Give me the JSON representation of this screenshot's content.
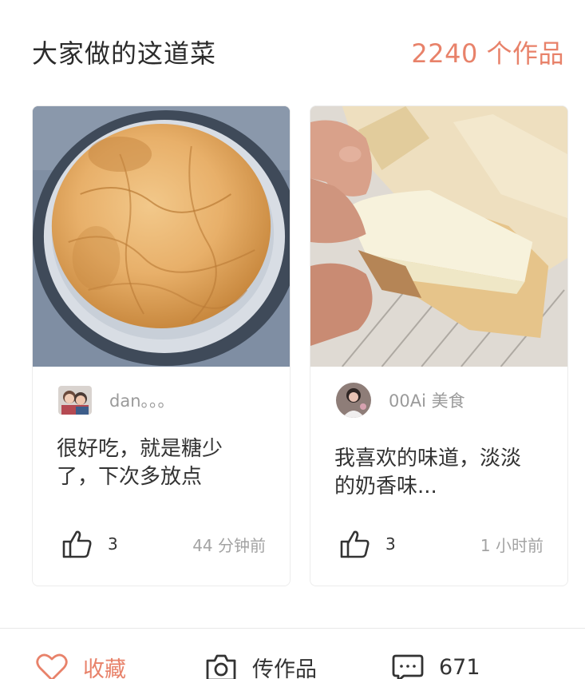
{
  "header": {
    "title": "大家做的这道菜",
    "works_count": "2240 个作品"
  },
  "cards": [
    {
      "author": "dan。。。",
      "comment_line1": "很好吃，就是糖少",
      "comment_line2": "了，下次多放点",
      "likes": "3",
      "time": "44 分钟前"
    },
    {
      "author": "00Ai 美食",
      "comment_line1": "我喜欢的味道，淡淡",
      "comment_line2": "的奶香味...",
      "likes": "3",
      "time": "1 小时前"
    }
  ],
  "bottom_bar": {
    "favorite_label": "收藏",
    "upload_label": "传作品",
    "comment_count": "671"
  },
  "icons": {
    "favorite": "heart-icon",
    "upload": "camera-icon",
    "comment": "speech-bubble-icon",
    "like": "thumbs-up-icon"
  },
  "colors": {
    "accent": "#e8826a",
    "text": "#333333",
    "muted": "#9a9a9a"
  }
}
